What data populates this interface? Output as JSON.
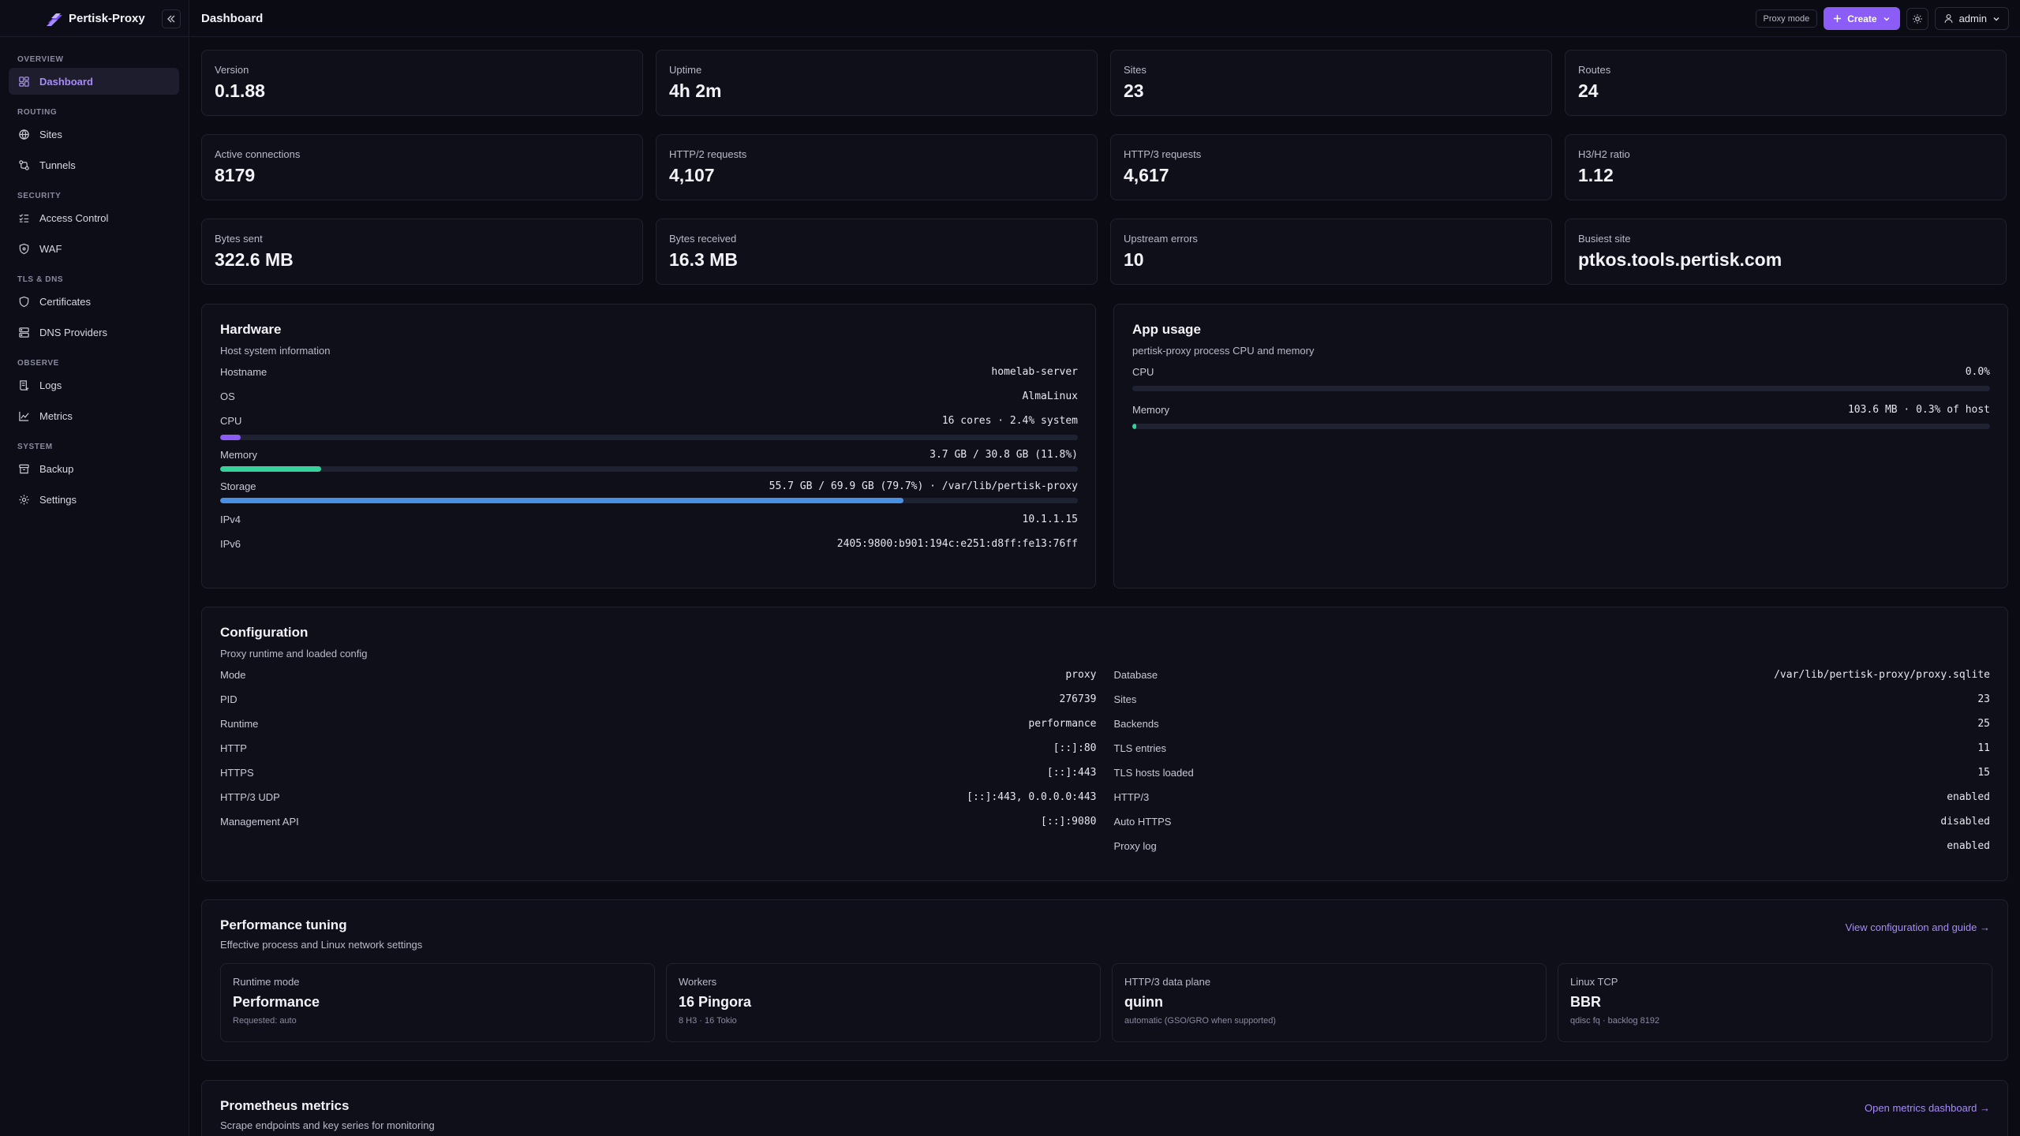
{
  "app": {
    "name": "Pertisk-Proxy"
  },
  "sidebar": {
    "sections": [
      {
        "title": "OVERVIEW",
        "items": [
          {
            "label": "Dashboard",
            "icon": "dashboard-icon",
            "active": true
          }
        ]
      },
      {
        "title": "ROUTING",
        "items": [
          {
            "label": "Sites",
            "icon": "globe-icon"
          },
          {
            "label": "Tunnels",
            "icon": "tunnel-icon"
          }
        ]
      },
      {
        "title": "SECURITY",
        "items": [
          {
            "label": "Access Control",
            "icon": "list-check-icon"
          },
          {
            "label": "WAF",
            "icon": "shield-icon"
          }
        ]
      },
      {
        "title": "TLS & DNS",
        "items": [
          {
            "label": "Certificates",
            "icon": "shield-icon"
          },
          {
            "label": "DNS Providers",
            "icon": "server-icon"
          }
        ]
      },
      {
        "title": "OBSERVE",
        "items": [
          {
            "label": "Logs",
            "icon": "logs-icon"
          },
          {
            "label": "Metrics",
            "icon": "chart-icon"
          }
        ]
      },
      {
        "title": "SYSTEM",
        "items": [
          {
            "label": "Backup",
            "icon": "archive-icon"
          },
          {
            "label": "Settings",
            "icon": "gear-icon"
          }
        ]
      }
    ]
  },
  "header": {
    "title": "Dashboard",
    "mode_badge": "Proxy mode",
    "create_label": "Create",
    "user_label": "admin"
  },
  "stats": [
    {
      "label": "Version",
      "value": "0.1.88"
    },
    {
      "label": "Uptime",
      "value": "4h 2m"
    },
    {
      "label": "Sites",
      "value": "23"
    },
    {
      "label": "Routes",
      "value": "24"
    },
    {
      "label": "Active connections",
      "value": "8179"
    },
    {
      "label": "HTTP/2 requests",
      "value": "4,107"
    },
    {
      "label": "HTTP/3 requests",
      "value": "4,617"
    },
    {
      "label": "H3/H2 ratio",
      "value": "1.12"
    },
    {
      "label": "Bytes sent",
      "value": "322.6 MB"
    },
    {
      "label": "Bytes received",
      "value": "16.3 MB"
    },
    {
      "label": "Upstream errors",
      "value": "10"
    },
    {
      "label": "Busiest site",
      "value": "ptkos.tools.pertisk.com"
    }
  ],
  "hardware": {
    "title": "Hardware",
    "subtitle": "Host system information",
    "hostname": {
      "label": "Hostname",
      "value": "homelab-server"
    },
    "os": {
      "label": "OS",
      "value": "AlmaLinux"
    },
    "cpu": {
      "label": "CPU",
      "value": "16 cores · 2.4% system",
      "percent": 2.4,
      "color": "#8b5cf6"
    },
    "memory": {
      "label": "Memory",
      "value": "3.7 GB / 30.8 GB (11.8%)",
      "percent": 11.8,
      "color": "#34d399"
    },
    "storage": {
      "label": "Storage",
      "value": "55.7 GB / 69.9 GB (79.7%) · /var/lib/pertisk-proxy",
      "percent": 79.7,
      "color": "#4a90e2"
    },
    "ipv4": {
      "label": "IPv4",
      "value": "10.1.1.15"
    },
    "ipv6": {
      "label": "IPv6",
      "value": "2405:9800:b901:194c:e251:d8ff:fe13:76ff"
    }
  },
  "app_usage": {
    "title": "App usage",
    "subtitle": "pertisk-proxy process CPU and memory",
    "cpu": {
      "label": "CPU",
      "value": "0.0%",
      "percent": 0.0,
      "color": "#8b5cf6"
    },
    "memory": {
      "label": "Memory",
      "value": "103.6 MB · 0.3% of host",
      "percent": 0.3,
      "color": "#34d399"
    }
  },
  "configuration": {
    "title": "Configuration",
    "subtitle": "Proxy runtime and loaded config",
    "left": [
      {
        "label": "Mode",
        "value": "proxy"
      },
      {
        "label": "PID",
        "value": "276739"
      },
      {
        "label": "Runtime",
        "value": "performance"
      },
      {
        "label": "HTTP",
        "value": "[::]:80"
      },
      {
        "label": "HTTPS",
        "value": "[::]:443"
      },
      {
        "label": "HTTP/3 UDP",
        "value": "[::]:443, 0.0.0.0:443"
      },
      {
        "label": "Management API",
        "value": "[::]:9080"
      }
    ],
    "right": [
      {
        "label": "Database",
        "value": "/var/lib/pertisk-proxy/proxy.sqlite"
      },
      {
        "label": "Sites",
        "value": "23"
      },
      {
        "label": "Backends",
        "value": "25"
      },
      {
        "label": "TLS entries",
        "value": "11"
      },
      {
        "label": "TLS hosts loaded",
        "value": "15"
      },
      {
        "label": "HTTP/3",
        "value": "enabled"
      },
      {
        "label": "Auto HTTPS",
        "value": "disabled"
      },
      {
        "label": "Proxy log",
        "value": "enabled"
      }
    ]
  },
  "performance": {
    "title": "Performance tuning",
    "subtitle": "Effective process and Linux network settings",
    "link": "View configuration and guide →",
    "cards": [
      {
        "label": "Runtime mode",
        "value": "Performance",
        "note": "Requested: auto"
      },
      {
        "label": "Workers",
        "value": "16 Pingora",
        "note": "8 H3 · 16 Tokio"
      },
      {
        "label": "HTTP/3 data plane",
        "value": "quinn",
        "note": "automatic (GSO/GRO when supported)"
      },
      {
        "label": "Linux TCP",
        "value": "BBR",
        "note": "qdisc fq · backlog 8192"
      }
    ]
  },
  "prometheus": {
    "title": "Prometheus metrics",
    "subtitle": "Scrape endpoints and key series for monitoring",
    "link": "Open metrics dashboard →"
  }
}
